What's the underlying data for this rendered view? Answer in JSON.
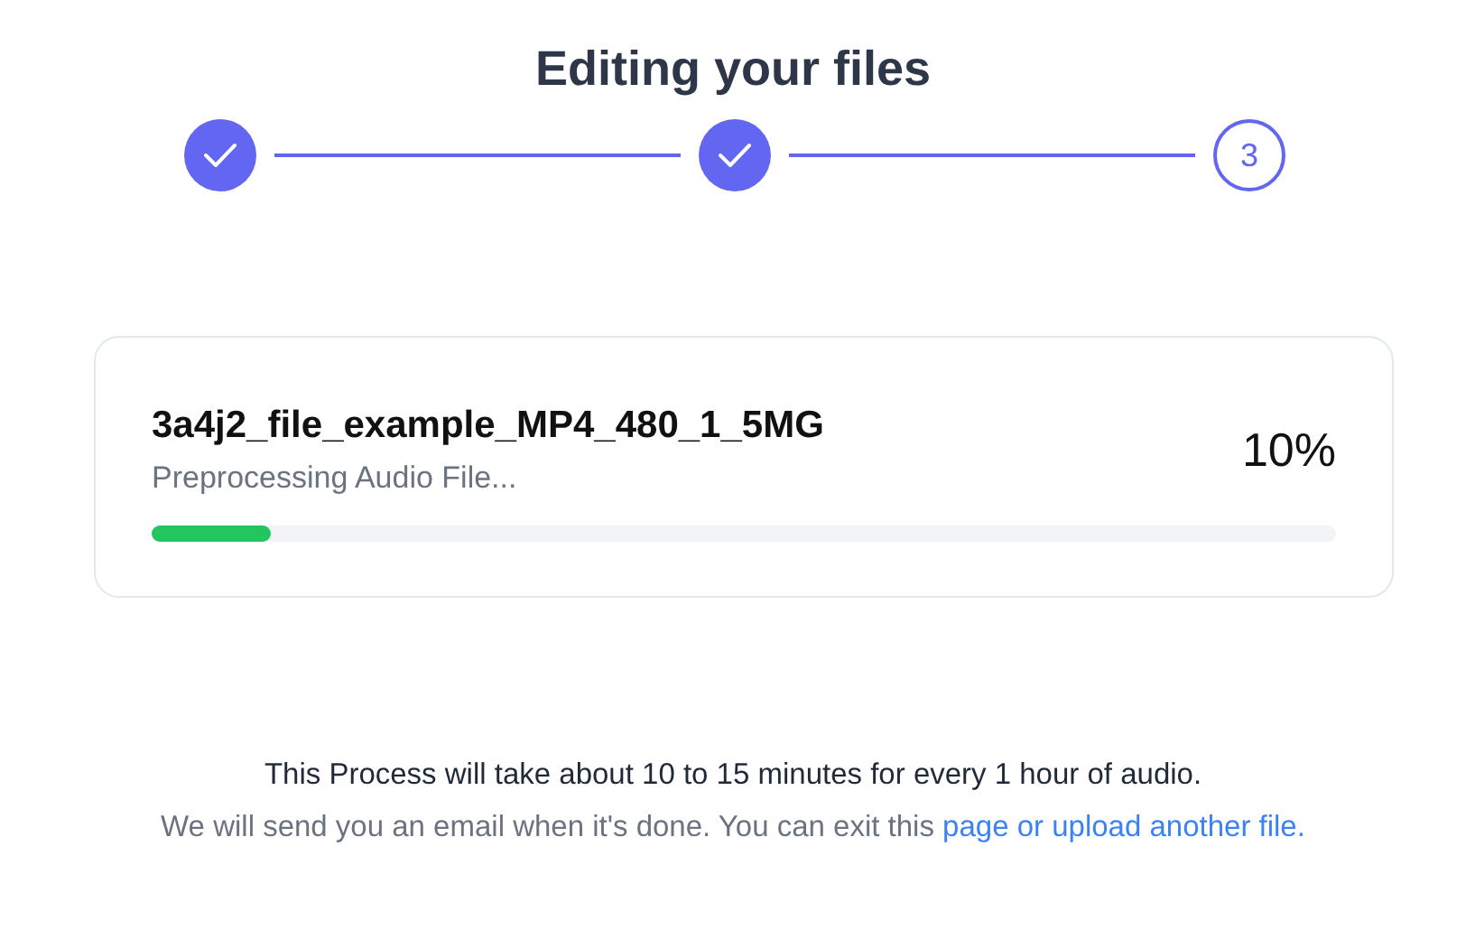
{
  "title": "Editing your files",
  "steps": [
    {
      "done": true
    },
    {
      "done": true
    },
    {
      "done": false,
      "label": "3"
    }
  ],
  "job": {
    "file_name": "3a4j2_file_example_MP4_480_1_5MG",
    "status": "Preprocessing Audio File...",
    "percent": "10%",
    "level": 0.1
  },
  "footer": {
    "note": "This Process will take about 10 to 15 minutes for every 1 hour of audio.",
    "message": "We will send you an email when it's done. You can exit this ",
    "link": "page or upload another file."
  }
}
